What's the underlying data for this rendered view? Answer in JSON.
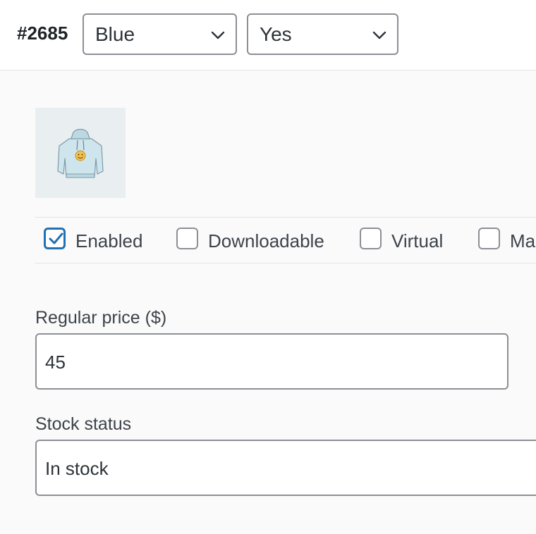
{
  "header": {
    "variation_id": "#2685",
    "attribute_selects": [
      {
        "value": "Blue"
      },
      {
        "value": "Yes"
      }
    ]
  },
  "image": {
    "icon": "hoodie-thumbnail"
  },
  "options": {
    "enabled": {
      "label": "Enabled",
      "checked": true
    },
    "downloadable": {
      "label": "Downloadable",
      "checked": false
    },
    "virtual": {
      "label": "Virtual",
      "checked": false
    },
    "manage_stock": {
      "label": "Mar",
      "checked": false
    }
  },
  "fields": {
    "regular_price": {
      "label": "Regular price ($)",
      "value": "45"
    },
    "stock_status": {
      "label": "Stock status",
      "value": "In stock"
    }
  },
  "colors": {
    "accent": "#2271b1",
    "border": "#8c8f94"
  }
}
